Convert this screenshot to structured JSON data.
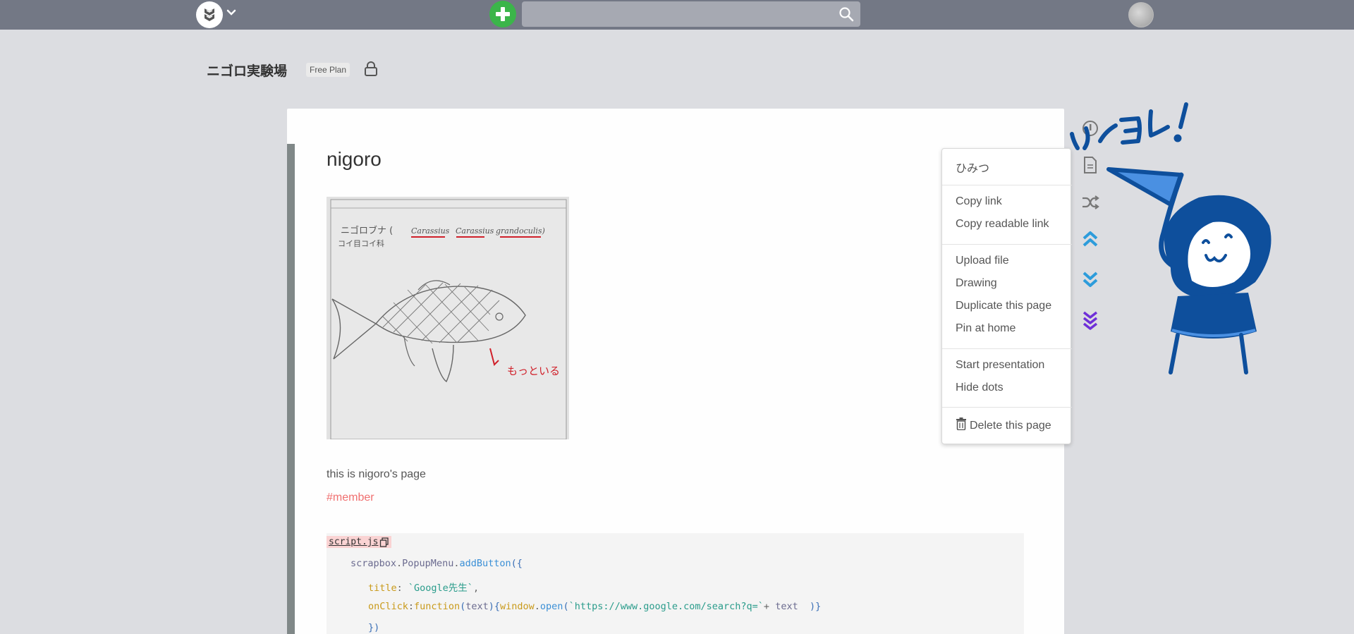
{
  "navbar": {
    "search": {
      "placeholder": "",
      "value": ""
    }
  },
  "project": {
    "title": "ニゴロ実験場",
    "plan_badge": "Free Plan"
  },
  "page": {
    "title": "nigoro",
    "text_line": "this is nigoro's page",
    "tag": "#member",
    "image_text": {
      "heading": "ニゴロブナ (",
      "latin1": "Carassius",
      "latin2": "Carassius",
      "latin3": "grandoculis)",
      "family": "コイ目コイ科",
      "note": "もっといる"
    },
    "code": {
      "title": "script.js",
      "lines": [
        {
          "parts": [
            "scrapbox",
            ".",
            "PopupMenu",
            ".",
            "addButton",
            "({"
          ]
        },
        {
          "parts": [
            "title",
            ": ",
            "`Google先生`",
            ","
          ]
        },
        {
          "parts": [
            "onClick",
            ":",
            "function",
            "(",
            "text",
            "){",
            "window",
            ".",
            "open",
            "(",
            "`https://www.google.com/search?q=`",
            "+ ",
            "text",
            "  )}"
          ]
        },
        {
          "parts": [
            "})"
          ]
        }
      ]
    }
  },
  "popup_menu": {
    "items": [
      "ひみつ",
      "Copy link",
      "Copy readable link",
      "Upload file",
      "Drawing",
      "Duplicate this page",
      "Pin at home",
      "Start presentation",
      "Hide dots",
      "Delete this page"
    ]
  },
  "side_icons": [
    "info-icon",
    "document-icon",
    "shuffle-icon",
    "double-chevron-up-icon",
    "double-chevron-down-icon",
    "triple-chevron-down-icon"
  ],
  "colors": {
    "navbar": "#737885",
    "new_button": "#3bb54a",
    "tag": "#f07070",
    "character_blue": "#0e4f9c",
    "character_light": "#4a90e2",
    "chevron_blue": "#2d9cdb",
    "chevron_purple": "#6f2fd8"
  }
}
